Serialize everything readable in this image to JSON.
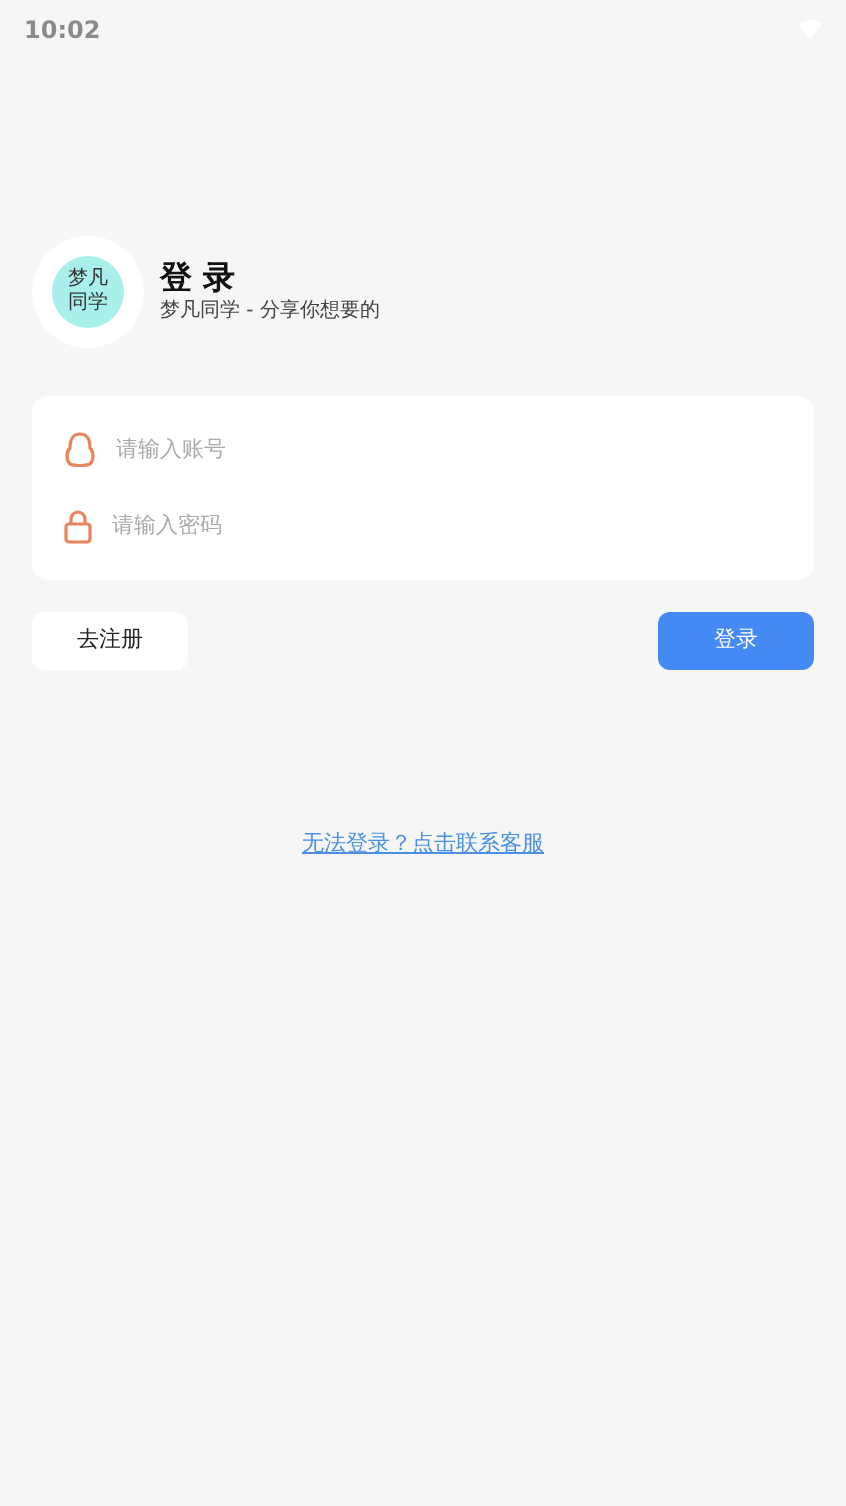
{
  "status_bar": {
    "time": "10:02"
  },
  "header": {
    "logo_lines": [
      "梦凡",
      "同学"
    ],
    "title": "登 录",
    "subtitle": "梦凡同学 - 分享你想要的"
  },
  "form": {
    "fields": [
      {
        "kind": "account",
        "placeholder": "请输入账号"
      },
      {
        "kind": "password",
        "placeholder": "请输入密码"
      }
    ]
  },
  "buttons": {
    "register": "去注册",
    "login": "登录"
  },
  "help_link": "无法登录？点击联系客服"
}
